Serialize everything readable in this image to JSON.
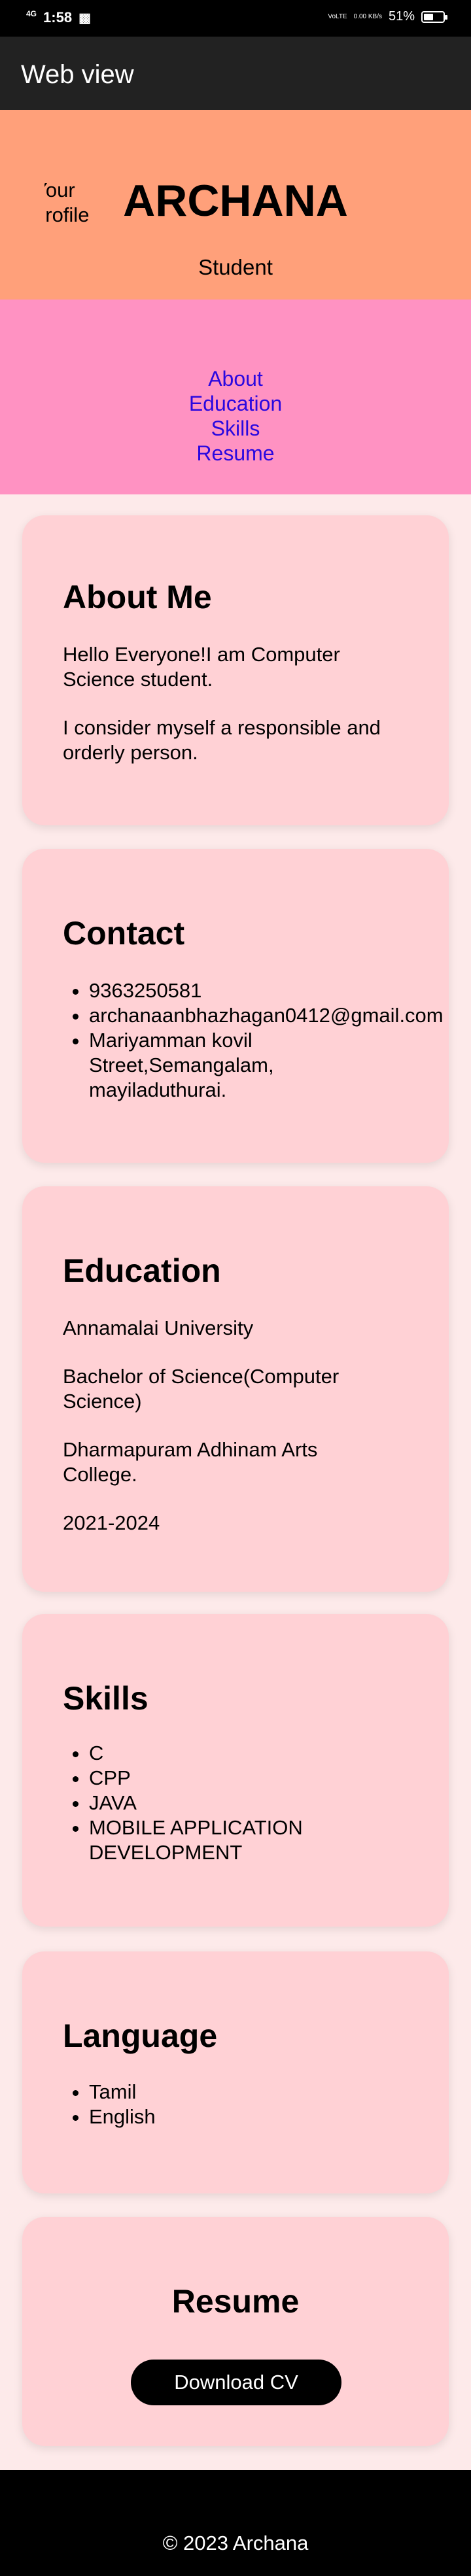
{
  "status_bar": {
    "network": "4G",
    "time": "1:58",
    "volte": "VoLTE",
    "speed": "0.00 KB/s",
    "battery_text": "51%",
    "battery_level": 0.51
  },
  "app_bar": {
    "title": "Web view"
  },
  "header": {
    "profile_alt": "Your profile picture",
    "name": "ARCHANA",
    "role": "Student"
  },
  "nav": {
    "items": [
      "About",
      "Education",
      "Skills",
      "Resume"
    ]
  },
  "about": {
    "heading": "About Me",
    "paragraphs": [
      "Hello Everyone!I am Computer Science student.",
      "I consider myself a responsible and orderly person."
    ]
  },
  "contact": {
    "heading": "Contact",
    "items": [
      "9363250581",
      "archanaanbhazhagan0412@gmail.com",
      "Mariyamman kovil Street,Semangalam, mayiladuthurai."
    ]
  },
  "education": {
    "heading": "Education",
    "lines": [
      "Annamalai University",
      "Bachelor of Science(Computer Science)",
      "Dharmapuram Adhinam Arts College.",
      "2021-2024"
    ]
  },
  "skills": {
    "heading": "Skills",
    "items": [
      "C",
      "CPP",
      "JAVA",
      "MOBILE APPLICATION DEVELOPMENT"
    ]
  },
  "language": {
    "heading": "Language",
    "items": [
      "Tamil",
      "English"
    ]
  },
  "resume": {
    "heading": "Resume",
    "button_label": "Download CV"
  },
  "footer": {
    "text": "© 2023 Archana"
  },
  "colors": {
    "page_bg": "#fdeaea",
    "header_bg": "#ffa07a",
    "nav_bg": "#ff92c2",
    "card_bg": "#ffd1d5",
    "link": "#2a08e0"
  }
}
